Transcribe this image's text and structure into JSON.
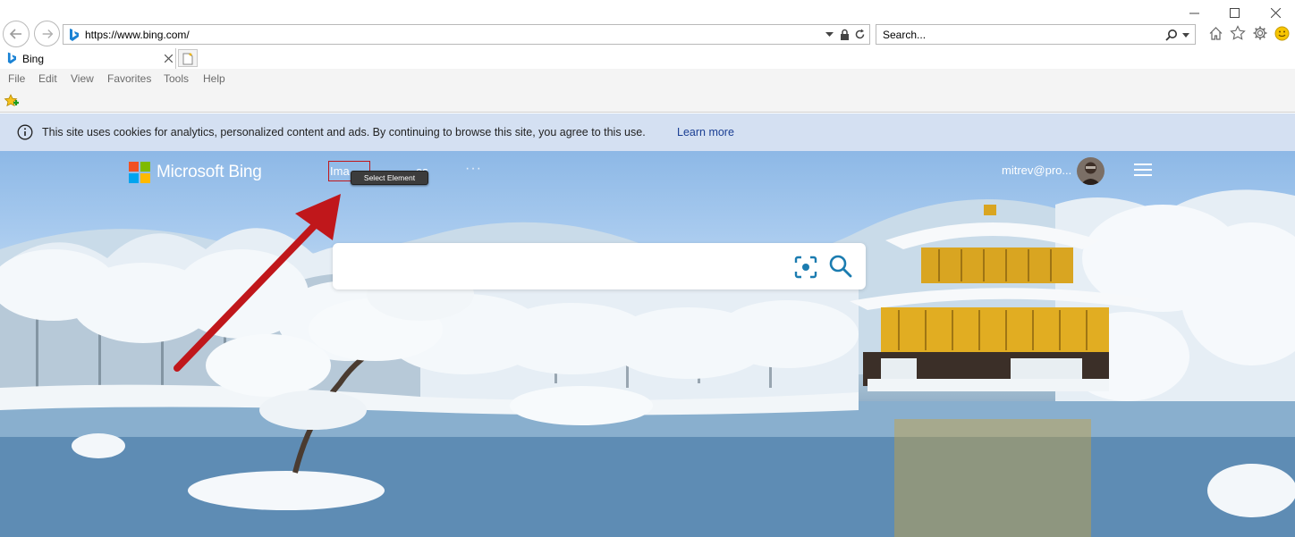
{
  "browser": {
    "address_url": "https://www.bing.com/",
    "search_placeholder": "Search...",
    "tab_title": "Bing"
  },
  "menu": {
    "items": [
      "File",
      "Edit",
      "View",
      "Favorites",
      "Tools",
      "Help"
    ]
  },
  "cookie_banner": {
    "text": "This site uses cookies for analytics, personalized content and ads. By continuing to browse this site, you agree to this use.",
    "link": "Learn more"
  },
  "bing": {
    "logo_text": "Microsoft Bing",
    "nav_images": "Ima",
    "nav_videos": "os",
    "nav_more": "···",
    "user": "mitrev@pro...",
    "search_value": ""
  },
  "annotation": {
    "tooltip": "Select Element",
    "arrow_color": "#c0171b"
  },
  "colors": {
    "ms_red": "#f25022",
    "ms_green": "#7fba00",
    "ms_blue": "#00a4ef",
    "ms_yellow": "#ffb900",
    "search_icon": "#1b7cb0"
  },
  "icons": [
    "back-icon",
    "forward-icon",
    "bing-favicon",
    "dropdown-icon",
    "lock-icon",
    "refresh-icon",
    "search-icon",
    "home-icon",
    "favorites-star-icon",
    "gear-icon",
    "smiley-icon",
    "close-icon",
    "new-tab-icon",
    "favorites-add-icon",
    "info-icon",
    "visual-search-icon",
    "hamburger-icon"
  ]
}
